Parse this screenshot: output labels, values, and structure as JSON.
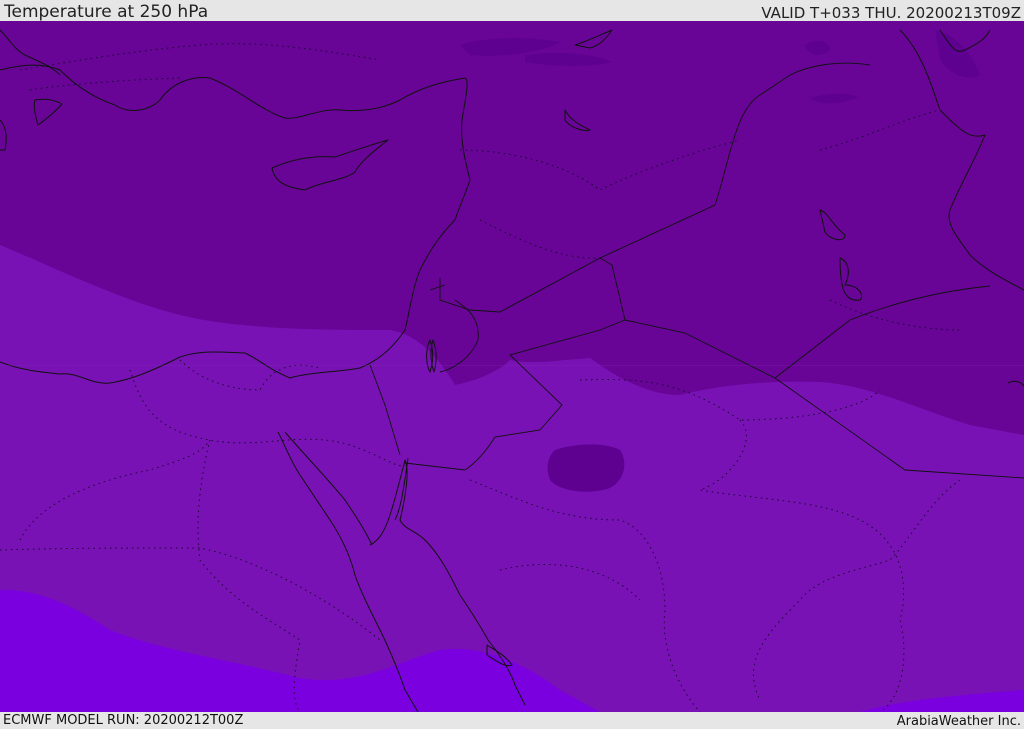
{
  "header": {
    "title": "Temperature at 250 hPa",
    "valid_time": "VALID T+033 THU. 20200213T09Z"
  },
  "footer": {
    "model_run": "ECMWF MODEL RUN: 20200212T00Z",
    "credit": "ArabiaWeather Inc."
  },
  "map": {
    "parameter": "temperature",
    "level": "250 hPa",
    "colors": {
      "coldest_band": "#5e0090",
      "cold_band": "#680596",
      "mid_band": "#7912b4",
      "warm_band": "#7a00e0",
      "coastline": "#111111"
    }
  }
}
